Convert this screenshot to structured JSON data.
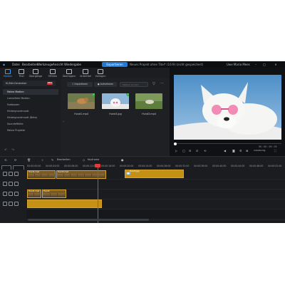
{
  "menubar": {
    "items": [
      "Datei",
      "Bearbeiten",
      "Werkzeuge",
      "Ansicht",
      "Wiedergabe"
    ],
    "export_label": "Exportieren",
    "project_title": "Neues Projekt ohne Titel* (16:9) (nicht gespeichert)",
    "user_name": "Uwe Maria Mees",
    "window_buttons": [
      "–",
      "□",
      "✕"
    ]
  },
  "media_tabs": [
    {
      "label": "Medien",
      "icon": "media-icon"
    },
    {
      "label": "Titel",
      "icon": "title-icon"
    },
    {
      "label": "Übergänge",
      "icon": "transitions-icon"
    },
    {
      "label": "Effekte",
      "icon": "effects-icon"
    },
    {
      "label": "Überlagern",
      "icon": "overlay-icon"
    },
    {
      "label": "Untertitel",
      "icon": "subtitles-icon"
    },
    {
      "label": "Vorlagen",
      "icon": "templates-icon"
    }
  ],
  "sidebar": {
    "header": "KI-Bild-Generator",
    "badge": "NEW",
    "items": [
      "Meine Medien",
      "Lizenzfreie Medien",
      "Farbboxen",
      "Hintergrundmusik",
      "Hintergrundmusik (Beta)",
      "Soundeffekte",
      "Meine Projekte"
    ]
  },
  "media": {
    "import_label": "Importieren",
    "record_label": "Aufnehmen",
    "search_placeholder": "Medien suchen",
    "thumbs": [
      {
        "name": "Hund1.mp4",
        "checked": true
      },
      {
        "name": "Hund3.jpg",
        "checked": true
      },
      {
        "name": "Hund3.mp4",
        "checked": false
      }
    ]
  },
  "preview": {
    "timecode": "00 : 00 : 09 : 03",
    "quality": "Vollständig"
  },
  "timeline": {
    "split_label": "Bearbeiten",
    "keyframe_label": "Keyframe",
    "ruler": [
      "00:00:00:00",
      "00:00:04:00",
      "00:00:08:00",
      "00:00:12:00",
      "00:00:16:00",
      "00:00:20:00",
      "00:00:24:00",
      "00:00:28:00",
      "00:00:32:00",
      "00:00:36:00",
      "00:00:40:00",
      "00:00:44:00",
      "00:00:48:00",
      "00:00:52:00"
    ],
    "clips": {
      "a": "Hund1.mp4",
      "b": "Hund3.mp4",
      "c": "Hund3.jpg",
      "d": "Hund1.mp4",
      "e": "Hund3"
    }
  },
  "colors": {
    "accent": "#1e7bd9",
    "clip_border": "#d8a534",
    "clip_gold": "#c49114",
    "playhead": "#e03c3c"
  }
}
